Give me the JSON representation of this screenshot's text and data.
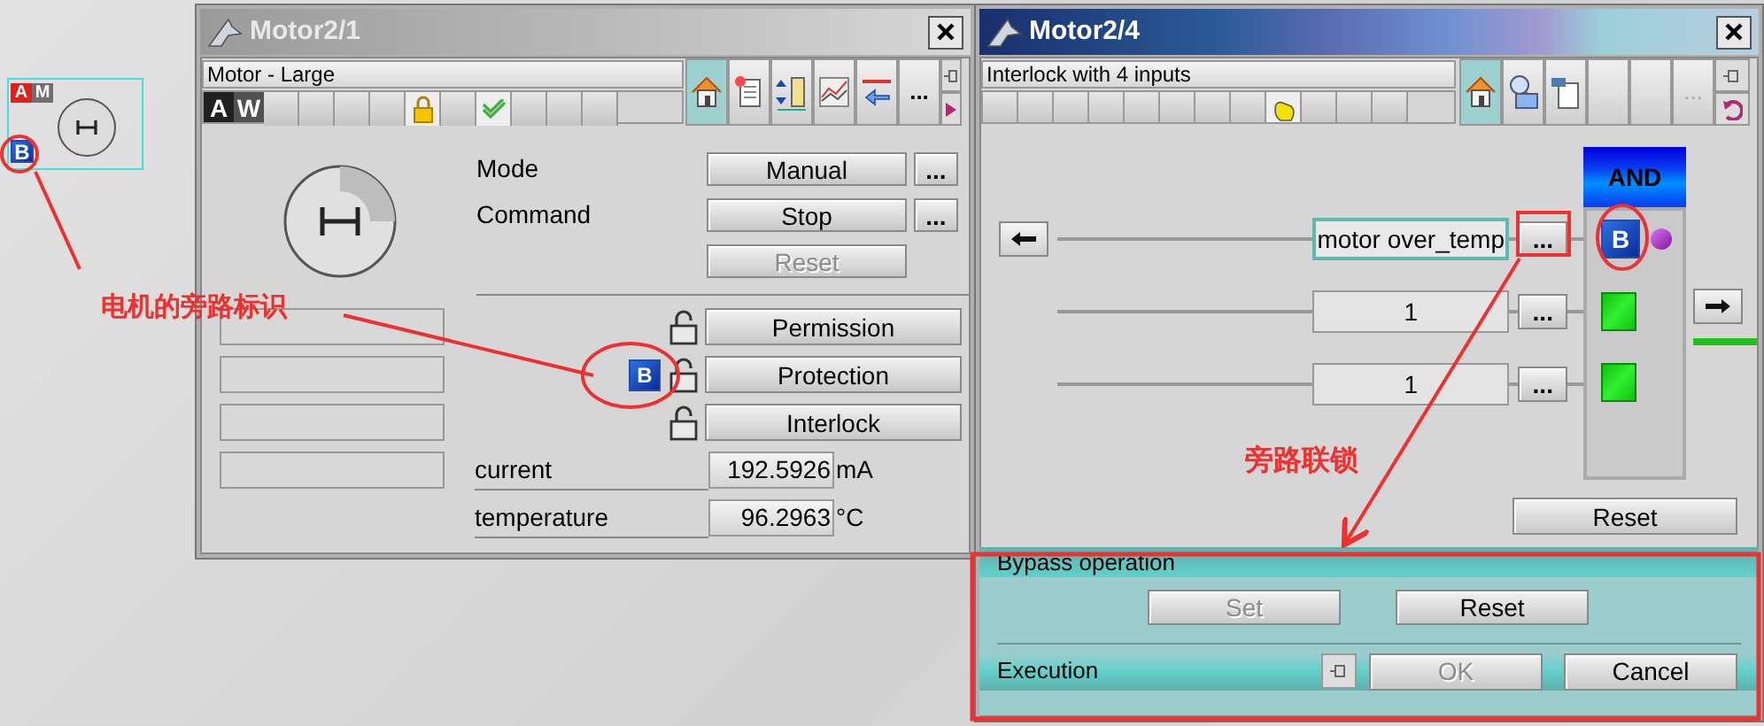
{
  "block_icon": {
    "badges": [
      {
        "text": "A",
        "color": "#e02020"
      },
      {
        "text": "M",
        "color": "#707070"
      }
    ],
    "bypass_badge": "B"
  },
  "motor_window": {
    "title": "Motor2/1",
    "subtitle": "Motor - Large",
    "status_letters": [
      {
        "text": "A",
        "color": "#202020"
      },
      {
        "text": "W",
        "color": "#505050"
      }
    ],
    "toolbar_more": "...",
    "controls": [
      {
        "label": "Mode",
        "button": "Manual",
        "more": "..."
      },
      {
        "label": "Command",
        "button": "Stop",
        "more": "..."
      }
    ],
    "reset": {
      "label": "Reset",
      "disabled": true
    },
    "interlocks": [
      {
        "label": "Permission",
        "bypassed": false
      },
      {
        "label": "Protection",
        "bypassed": true,
        "badge": "B"
      },
      {
        "label": "Interlock",
        "bypassed": false
      }
    ],
    "measurements": [
      {
        "label": "current",
        "value": "192.5926",
        "unit": "mA"
      },
      {
        "label": "temperature",
        "value": "96.2963",
        "unit": "°C"
      }
    ]
  },
  "interlock_window": {
    "title": "Motor2/4",
    "subtitle": "Interlock with 4 inputs",
    "toolbar_more": "...",
    "gate": "AND",
    "inputs": [
      {
        "value": "motor over_temp",
        "more": "...",
        "kind": "bypass",
        "badge": "B",
        "highlighted": true
      },
      {
        "value": "1",
        "more": "...",
        "kind": "ok",
        "highlighted": false
      },
      {
        "value": "1",
        "more": "...",
        "kind": "ok",
        "highlighted": false
      }
    ],
    "reset": "Reset",
    "bypass_operation": {
      "title": "Bypass operation",
      "set": {
        "label": "Set",
        "disabled": true
      },
      "reset": {
        "label": "Reset",
        "disabled": false
      }
    },
    "execution": {
      "title": "Execution",
      "ok": {
        "label": "OK",
        "disabled": true
      },
      "cancel": {
        "label": "Cancel",
        "disabled": false
      }
    }
  },
  "annotations": [
    {
      "text": "电机的旁路标识"
    },
    {
      "text": "旁路联锁"
    }
  ]
}
